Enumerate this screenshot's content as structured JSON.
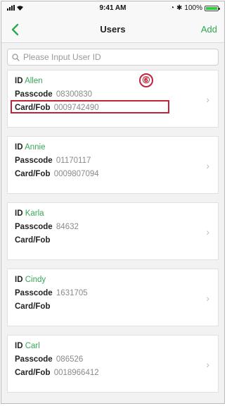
{
  "status_bar": {
    "time": "9:41 AM",
    "battery": "100%",
    "battery_level": 1.0,
    "signal_icon": "signal-icon",
    "wifi_icon": "wifi-icon",
    "bluetooth_icon": "bluetooth-icon"
  },
  "nav": {
    "title": "Users",
    "add_label": "Add",
    "back_icon": "chevron-left-icon"
  },
  "search": {
    "placeholder": "Please Input User ID",
    "value": ""
  },
  "labels": {
    "id": "ID",
    "passcode": "Passcode",
    "card": "Card/Fob"
  },
  "annotation": {
    "badge": "⑥"
  },
  "users": [
    {
      "name": "Allen",
      "passcode": "08300830",
      "card": "0009742490"
    },
    {
      "name": "Annie",
      "passcode": "01170117",
      "card": "0009807094"
    },
    {
      "name": "Karla",
      "passcode": "84632",
      "card": ""
    },
    {
      "name": "Cindy",
      "passcode": "1631705",
      "card": ""
    },
    {
      "name": "Carl",
      "passcode": "086526",
      "card": "0018966412"
    }
  ],
  "colors": {
    "accent": "#2fa84f",
    "highlight": "#c0243c"
  }
}
